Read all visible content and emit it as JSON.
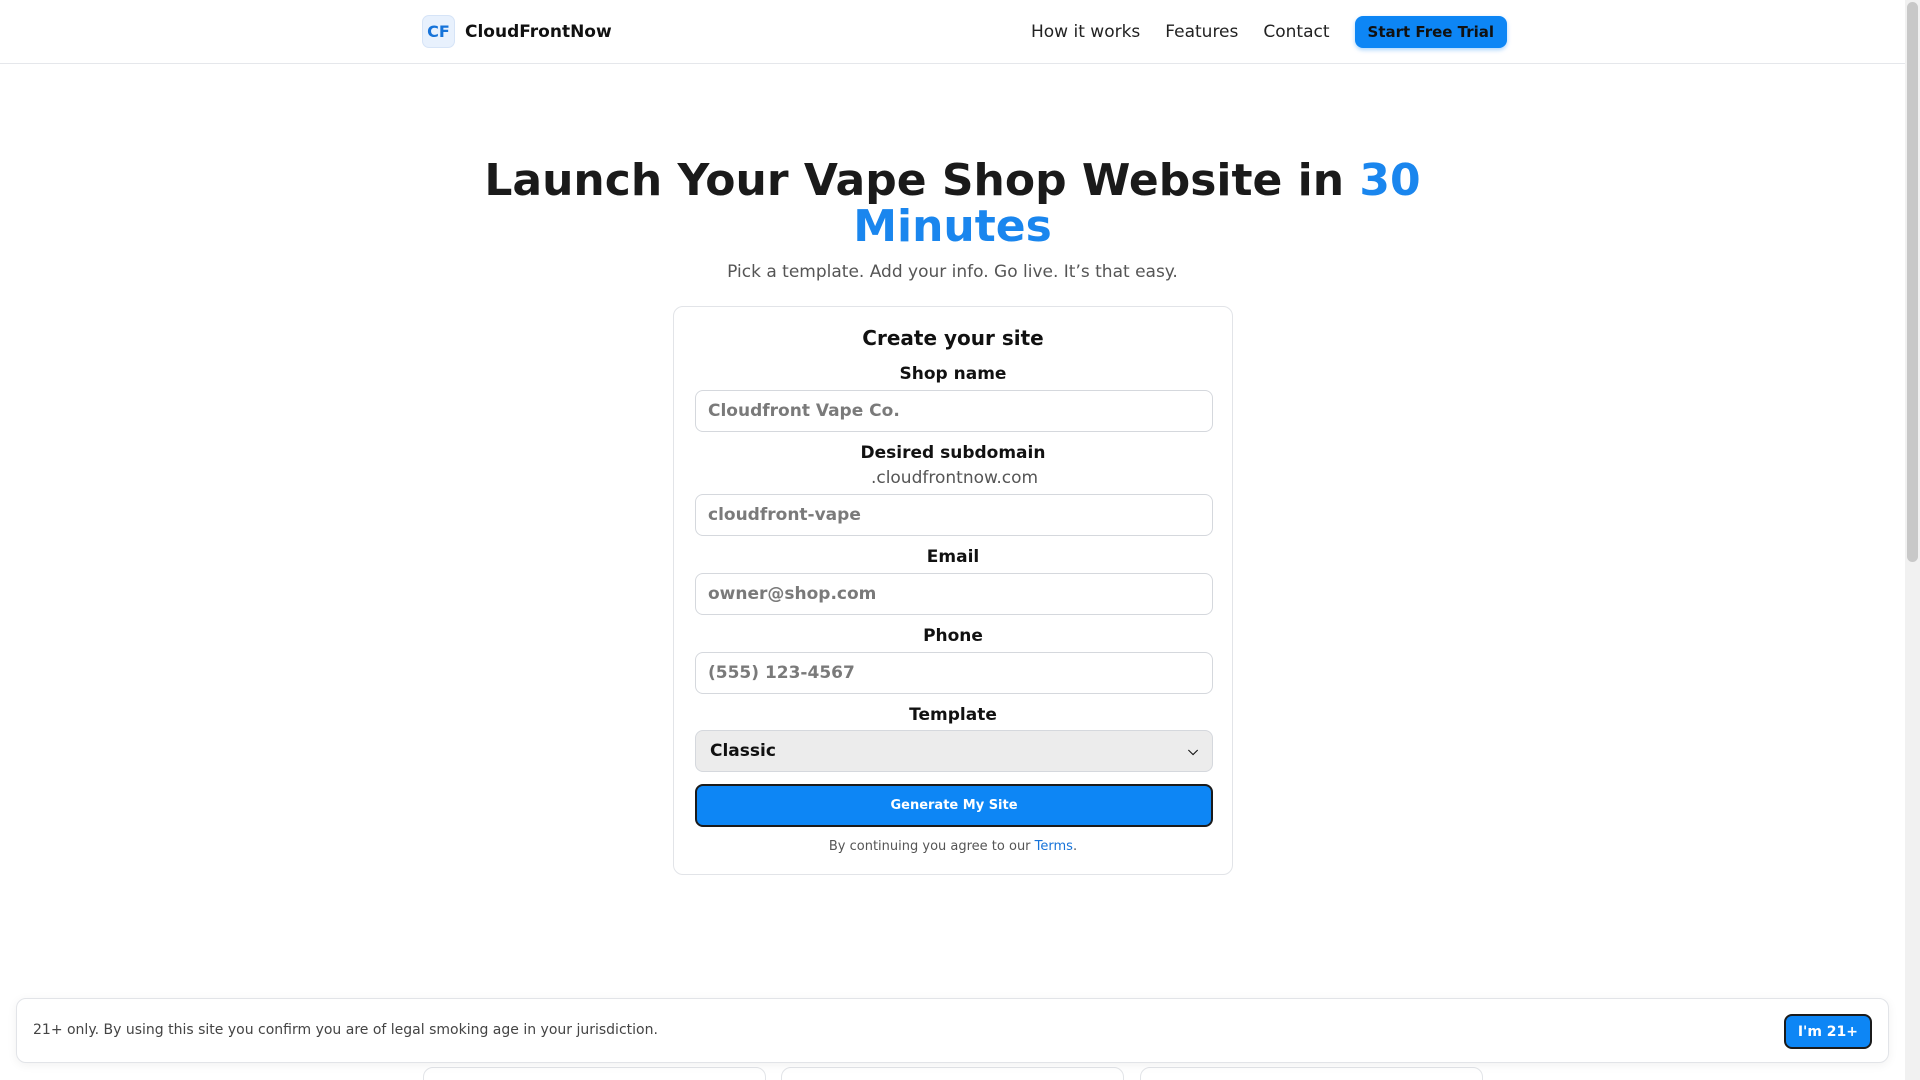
{
  "header": {
    "logo_text": "CF",
    "brand_name": "CloudFrontNow",
    "nav": [
      "How it works",
      "Features",
      "Contact"
    ],
    "cta_label": "Start Free Trial"
  },
  "hero": {
    "title_main": "Launch Your Vape Shop Website in ",
    "title_accent": "30 Minutes",
    "subtitle": "Pick a template. Add your info. Go live. It’s that easy."
  },
  "form": {
    "title": "Create your site",
    "shop_name": {
      "label": "Shop name",
      "placeholder": "Cloudfront Vape Co."
    },
    "subdomain": {
      "label": "Desired subdomain",
      "suffix": ".cloudfrontnow.com",
      "placeholder": "cloudfront-vape"
    },
    "email": {
      "label": "Email",
      "placeholder": "owner@shop.com"
    },
    "phone": {
      "label": "Phone",
      "placeholder": "(555) 123-4567"
    },
    "template": {
      "label": "Template",
      "selected": "Classic"
    },
    "submit_label": "Generate My Site",
    "terms_prefix": "By continuing you agree to our ",
    "terms_link": "Terms",
    "terms_suffix": "."
  },
  "age_banner": {
    "text": "21+ only. By using this site you confirm you are of legal smoking age in your jurisdiction.",
    "button_label": "I'm 21+"
  },
  "colors": {
    "accent": "#0d86f5",
    "link": "#1673d9"
  }
}
